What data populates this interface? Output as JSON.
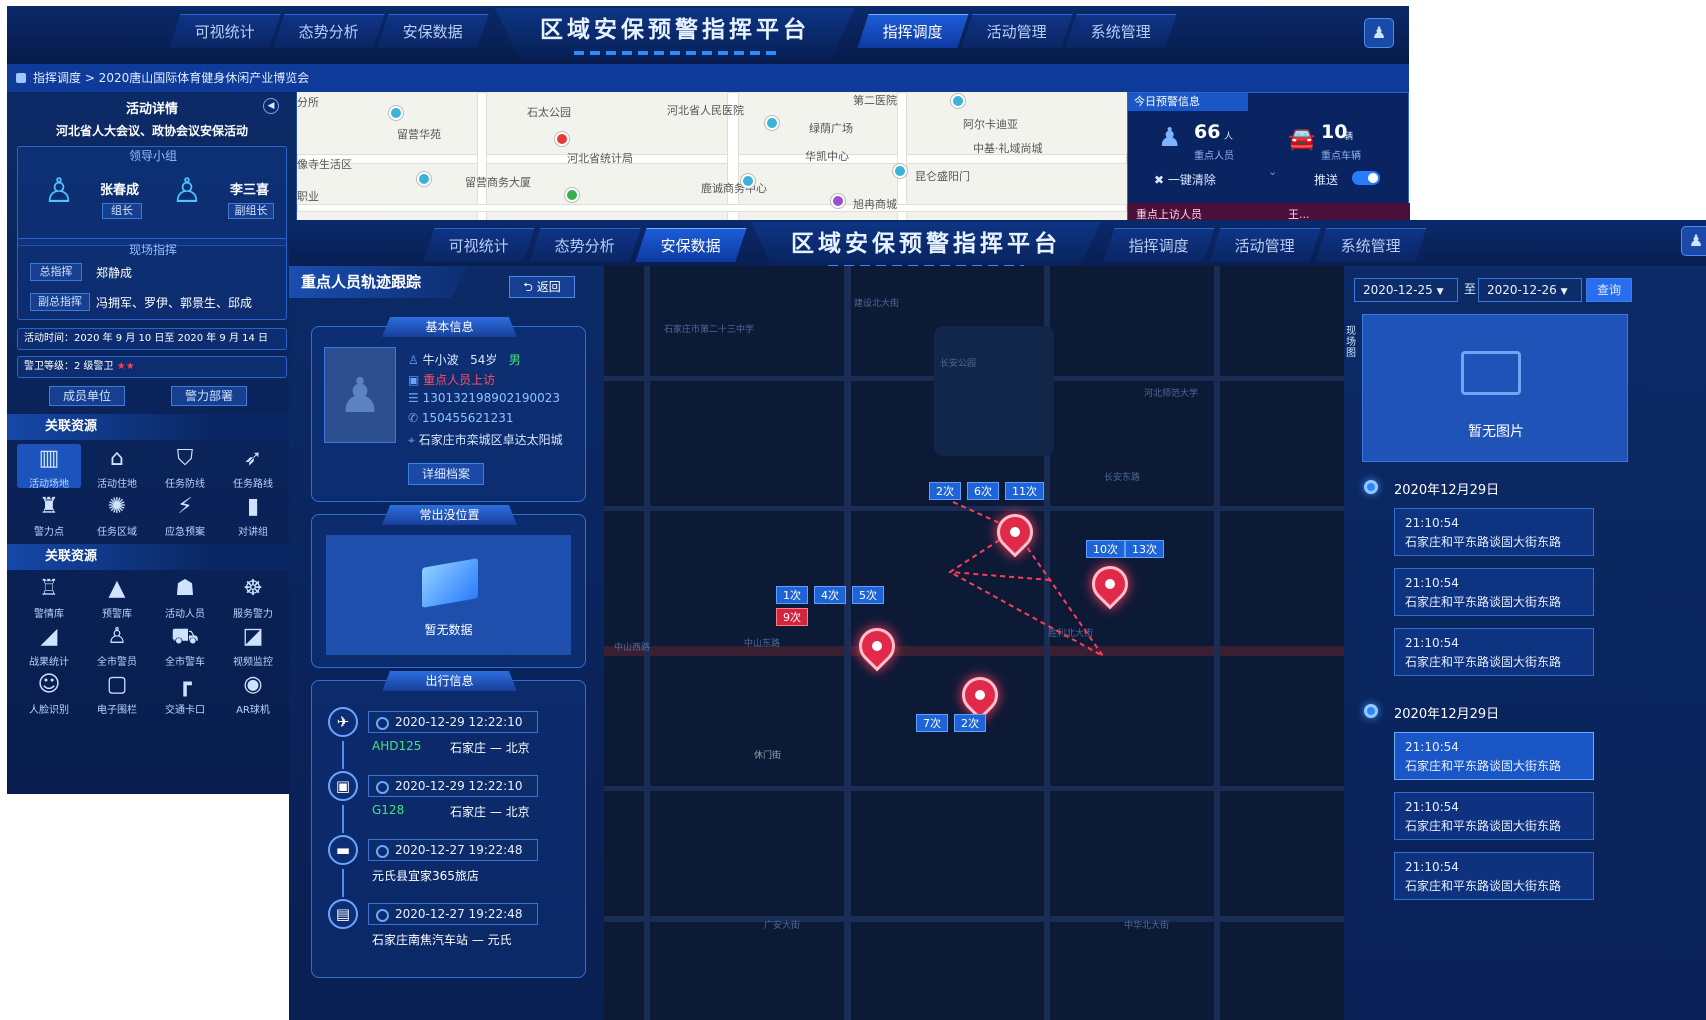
{
  "back": {
    "nav_left": [
      "可视统计",
      "态势分析",
      "安保数据"
    ],
    "title": "区域安保预警指挥平台",
    "nav_right": [
      "指挥调度",
      "活动管理",
      "系统管理"
    ],
    "breadcrumb": "指挥调度 > 2020唐山国际体育健身休闲产业博览会",
    "left_panel": {
      "title": "活动详情",
      "event_name": "河北省人大会议、政协会议安保活动",
      "leader_group_title": "领导小组",
      "leaders": [
        {
          "name": "张春成",
          "role": "组长"
        },
        {
          "name": "李三喜",
          "role": "副组长"
        }
      ],
      "onsite_title": "现场指挥",
      "chief_label": "总指挥",
      "chief": "郑静成",
      "deputy_label": "副总指挥",
      "deputies": "冯拥军、罗伊、郭景生、邱成",
      "activity_time": "活动时间：2020 年 9 月 10 日至 2020 年 9 月 14 日",
      "alert_level": "警卫等级：2 级警卫",
      "stars": "★★",
      "tab_members": "成员单位",
      "tab_deploy": "警力部署",
      "section1": "关联资源",
      "section2": "关联资源",
      "icons1": [
        {
          "label": "活动场地",
          "icon": "building-icon"
        },
        {
          "label": "活动住地",
          "icon": "house-icon"
        },
        {
          "label": "任务防线",
          "icon": "shield-icon"
        },
        {
          "label": "任务路线",
          "icon": "route-icon"
        },
        {
          "label": "警力点",
          "icon": "post-icon"
        },
        {
          "label": "任务区域",
          "icon": "area-icon"
        },
        {
          "label": "应急预案",
          "icon": "bolt-icon"
        },
        {
          "label": "对讲组",
          "icon": "radio-icon"
        }
      ],
      "icons2": [
        {
          "label": "警情库",
          "icon": "siren-icon"
        },
        {
          "label": "预警库",
          "icon": "warning-icon"
        },
        {
          "label": "活动人员",
          "icon": "person-icon"
        },
        {
          "label": "服务警力",
          "icon": "police-icon"
        },
        {
          "label": "战果统计",
          "icon": "chart-icon"
        },
        {
          "label": "全市警员",
          "icon": "officer-icon"
        },
        {
          "label": "全市警车",
          "icon": "car-icon"
        },
        {
          "label": "视频监控",
          "icon": "camera-icon"
        },
        {
          "label": "人脸识别",
          "icon": "face-icon"
        },
        {
          "label": "电子围栏",
          "icon": "fence-icon"
        },
        {
          "label": "交通卡口",
          "icon": "gate-icon"
        },
        {
          "label": "AR球机",
          "icon": "ar-camera-icon"
        }
      ]
    },
    "map_labels": [
      "石太公园",
      "河北省人民医院",
      "第二医院",
      "留营华苑",
      "绿荫广场",
      "阿尔卡迪亚",
      "像寺生活区",
      "河北省统计局",
      "华凯中心",
      "中基·礼域尚城",
      "留营商务大厦",
      "鹿诚商务中心",
      "昆仑盛阳门",
      "旭冉商城",
      "职业",
      "分所"
    ],
    "alert_panel": {
      "title": "今日预警信息",
      "persons_count": "66",
      "persons_unit": "人",
      "persons_label": "重点人员",
      "vehicles_count": "10",
      "vehicles_unit": "辆",
      "vehicles_label": "重点车辆",
      "clear_label": "一键清除",
      "push_label": "推送",
      "bottom_label": "重点上访人员",
      "bottom_right": "王..."
    }
  },
  "front": {
    "nav_left": [
      "可视统计",
      "态势分析",
      "安保数据"
    ],
    "title": "区域安保预警指挥平台",
    "nav_right": [
      "指挥调度",
      "活动管理",
      "系统管理"
    ],
    "panel_title": "重点人员轨迹跟踪",
    "back_button": "返回",
    "basic_info": {
      "title": "基本信息",
      "name": "牛小波",
      "age": "54岁",
      "gender": "男",
      "tag": "重点人员上访",
      "id_number": "130132198902190023",
      "phone": "150455621231",
      "address": "石家庄市栾城区卓达太阳城",
      "detail_button": "详细档案"
    },
    "frequent_location": {
      "title": "常出没位置",
      "empty": "暂无数据"
    },
    "travel": {
      "title": "出行信息",
      "items": [
        {
          "icon": "plane-icon",
          "time": "2020-12-29  12:22:10",
          "code": "AHD125",
          "route": "石家庄 — 北京"
        },
        {
          "icon": "train-icon",
          "time": "2020-12-29  12:22:10",
          "code": "G128",
          "route": "石家庄 — 北京"
        },
        {
          "icon": "hotel-icon",
          "time": "2020-12-27  19:22:48",
          "code": "",
          "route": "元氏县宜家365旅店"
        },
        {
          "icon": "bus-icon",
          "time": "2020-12-27  19:22:48",
          "code": "",
          "route": "石家庄南焦汽车站 — 元氏"
        }
      ]
    },
    "map_counts": [
      {
        "text": "2次",
        "red": false
      },
      {
        "text": "6次",
        "red": false
      },
      {
        "text": "11次",
        "red": false
      },
      {
        "text": "10次",
        "red": false
      },
      {
        "text": "13次",
        "red": false
      },
      {
        "text": "1次",
        "red": false
      },
      {
        "text": "4次",
        "red": false
      },
      {
        "text": "5次",
        "red": false
      },
      {
        "text": "9次",
        "red": true
      },
      {
        "text": "7次",
        "red": false
      },
      {
        "text": "2次",
        "red": false
      }
    ],
    "map_streets": [
      "中山东路",
      "中山西路",
      "休门街",
      "石家庄市第二十三中学",
      "长安公园",
      "河北师范大学",
      "长安东路",
      "建设北大街",
      "胜利北大街",
      "广安大街",
      "中华北大街"
    ],
    "right_panel": {
      "date_from": "2020-12-25",
      "to_label": "至",
      "date_to": "2020-12-26",
      "query_button": "查询",
      "side_label": "现场图",
      "no_image": "暂无图片",
      "groups": [
        {
          "date": "2020年12月29日",
          "items": [
            {
              "time": "21:10:54",
              "place": "石家庄和平东路谈固大街东路",
              "active": false
            },
            {
              "time": "21:10:54",
              "place": "石家庄和平东路谈固大街东路",
              "active": false
            },
            {
              "time": "21:10:54",
              "place": "石家庄和平东路谈固大街东路",
              "active": false
            }
          ]
        },
        {
          "date": "2020年12月29日",
          "items": [
            {
              "time": "21:10:54",
              "place": "石家庄和平东路谈固大街东路",
              "active": true
            },
            {
              "time": "21:10:54",
              "place": "石家庄和平东路谈固大街东路",
              "active": false
            },
            {
              "time": "21:10:54",
              "place": "石家庄和平东路谈固大街东路",
              "active": false
            }
          ]
        }
      ]
    }
  }
}
